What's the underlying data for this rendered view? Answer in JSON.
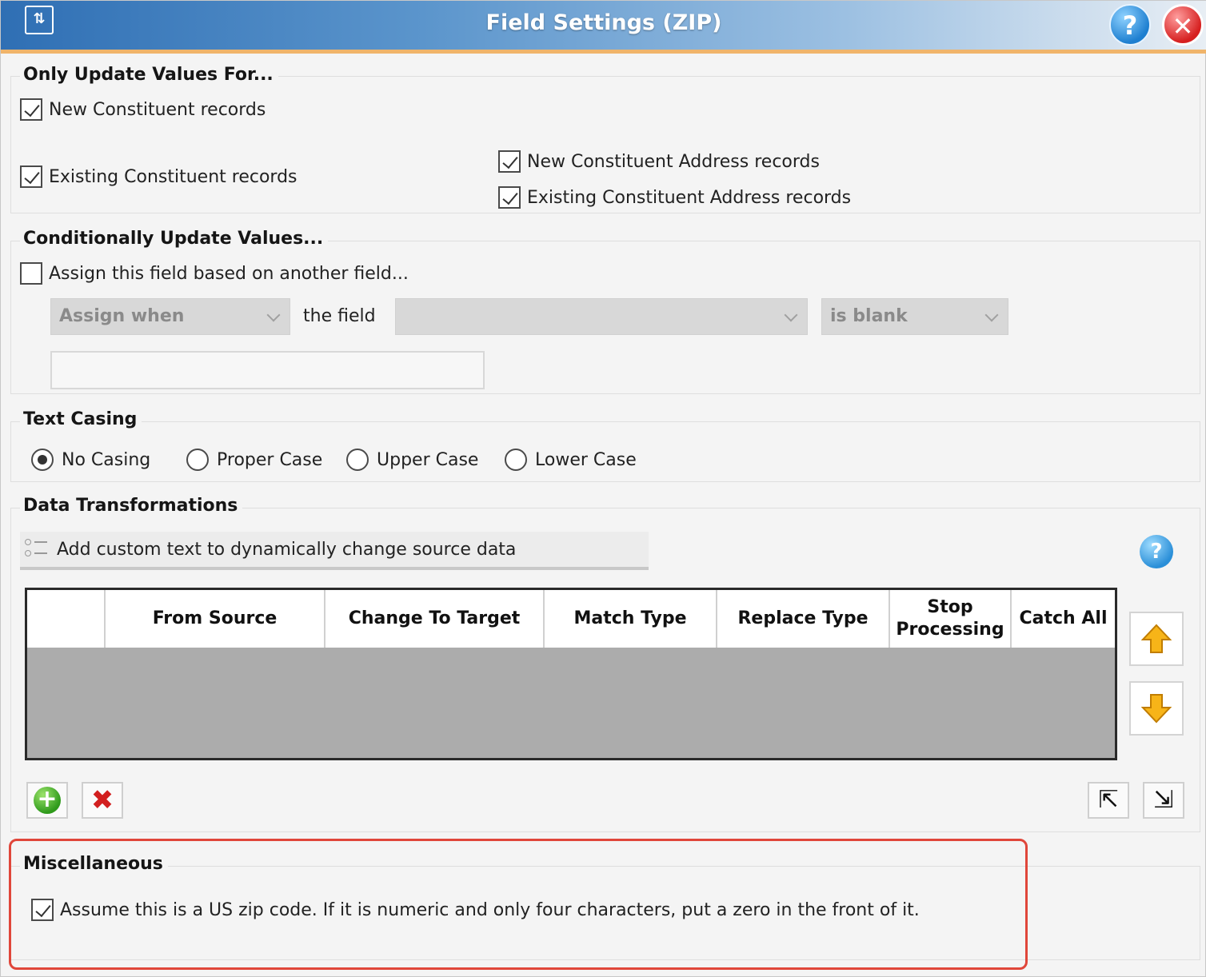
{
  "window": {
    "title": "Field Settings (ZIP)",
    "title_icon": "field-settings-icon",
    "help_label": "?",
    "close_label": "✕"
  },
  "only_update": {
    "legend": "Only Update Values For...",
    "items": [
      {
        "label": "New Constituent records",
        "checked": true
      },
      {
        "label": "Existing Constituent records",
        "checked": true
      },
      {
        "label": "New Constituent Address records",
        "checked": true
      },
      {
        "label": "Existing Constituent Address records",
        "checked": true
      }
    ]
  },
  "conditional": {
    "legend": "Conditionally Update Values...",
    "assign_label": "Assign this field based on another field...",
    "assign_checked": false,
    "assign_when": "Assign when",
    "the_field_label": "the field",
    "field_value": "",
    "condition": "is blank",
    "value_text": ""
  },
  "text_casing": {
    "legend": "Text Casing",
    "options": [
      {
        "label": "No Casing",
        "selected": true
      },
      {
        "label": "Proper Case",
        "selected": false
      },
      {
        "label": "Upper Case",
        "selected": false
      },
      {
        "label": "Lower Case",
        "selected": false
      }
    ]
  },
  "data_transformations": {
    "legend": "Data Transformations",
    "add_custom_label": "Add custom text to dynamically change source data",
    "help_label": "?",
    "columns": [
      "",
      "From Source",
      "Change To Target",
      "Match Type",
      "Replace Type",
      "Stop Processing",
      "Catch All"
    ],
    "rows": [],
    "move_up_icon": "arrow-up-icon",
    "move_down_icon": "arrow-down-icon",
    "add_icon_label": "+",
    "delete_icon_label": "✖",
    "export_icon_label": "⇱",
    "import_icon_label": "⇲"
  },
  "miscellaneous": {
    "legend": "Miscellaneous",
    "zip_label": "Assume this is a US zip code. If it is numeric and only four characters, put a zero in the front of it.",
    "zip_checked": true
  },
  "colors": {
    "titlebar_start": "#2f6fb4",
    "accent_bar": "#f0b46a",
    "highlight_border": "#e0463a",
    "grid_body": "#acacac"
  }
}
